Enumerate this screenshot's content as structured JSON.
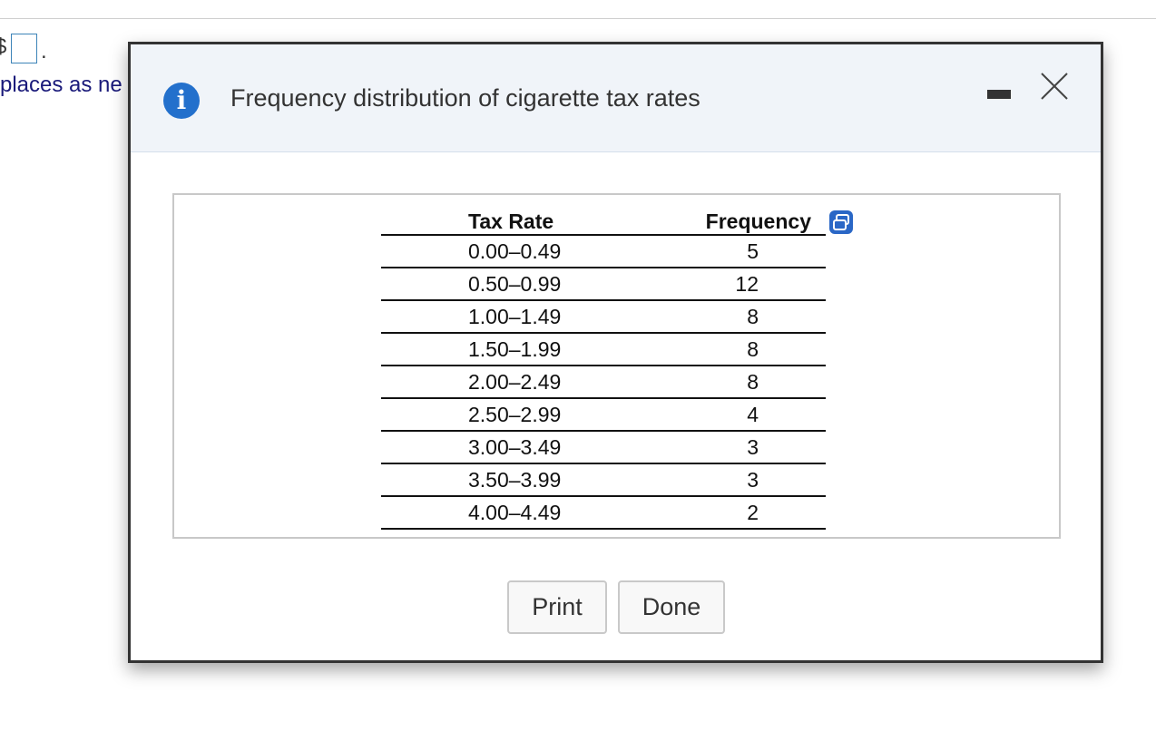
{
  "background": {
    "dollar_sign": "$",
    "decimal_point": ".",
    "instruction_fragment": "places as ne"
  },
  "dialog": {
    "title": "Frequency distribution of cigarette tax rates",
    "info_icon": "info-icon",
    "minimize_icon": "minimize-icon",
    "close_icon": "close-icon",
    "accent_color": "#2370cc"
  },
  "table": {
    "columns": [
      "Tax Rate",
      "Frequency"
    ],
    "rows": [
      {
        "tax_rate": "0.00–0.49",
        "frequency": "5"
      },
      {
        "tax_rate": "0.50–0.99",
        "frequency": "12"
      },
      {
        "tax_rate": "1.00–1.49",
        "frequency": "8"
      },
      {
        "tax_rate": "1.50–1.99",
        "frequency": "8"
      },
      {
        "tax_rate": "2.00–2.49",
        "frequency": "8"
      },
      {
        "tax_rate": "2.50–2.99",
        "frequency": "4"
      },
      {
        "tax_rate": "3.00–3.49",
        "frequency": "3"
      },
      {
        "tax_rate": "3.50–3.99",
        "frequency": "3"
      },
      {
        "tax_rate": "4.00–4.49",
        "frequency": "2"
      }
    ],
    "copy_icon": "copy-icon"
  },
  "buttons": {
    "print": "Print",
    "done": "Done"
  }
}
